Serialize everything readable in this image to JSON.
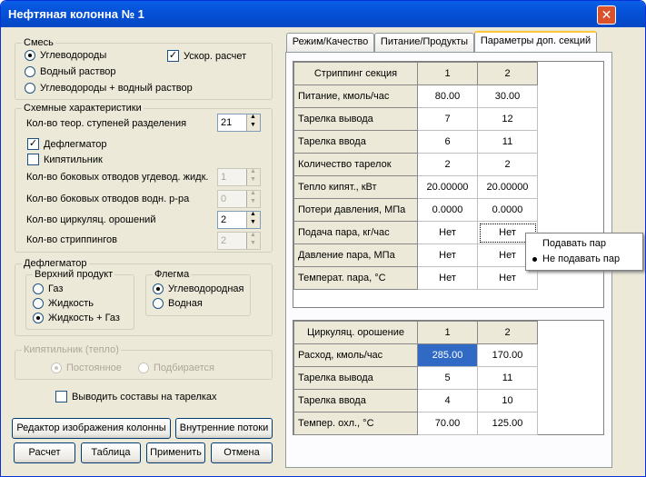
{
  "window": {
    "title": "Нефтяная колонна № 1",
    "close": "✕"
  },
  "mix": {
    "legend": "Смесь",
    "opt1": "Углеводороды",
    "opt2": "Водный раствор",
    "opt3": "Углеводороды + водный раствор",
    "accel": "Ускор. расчет"
  },
  "scheme": {
    "legend": "Схемные характеристики",
    "stages_label": "Кол-во теор. ступеней разделения",
    "stages_value": "21",
    "deflegm": "Дефлегматор",
    "boiler": "Кипятильник",
    "side_hc_label": "Кол-во боковых отводов угдевод. жидк.",
    "side_hc_value": "1",
    "side_w_label": "Кол-во боковых отводов водн. р-ра",
    "side_w_value": "0",
    "circ_label": "Кол-во циркуляц. орошений",
    "circ_value": "2",
    "strip_label": "Кол-во стриппингов",
    "strip_value": "2"
  },
  "defl": {
    "legend": "Дефлегматор",
    "top_legend": "Верхний продукт",
    "top1": "Газ",
    "top2": "Жидкость",
    "top3": "Жидкость + Газ",
    "phlegm_legend": "Флегма",
    "ph1": "Углеводородная",
    "ph2": "Водная"
  },
  "boil": {
    "legend": "Кипятильник  (тепло)",
    "o1": "Постоянное",
    "o2": "Подбирается"
  },
  "show_comp": "Выводить составы на тарелках",
  "buttons": {
    "editor": "Редактор изображения колонны",
    "flows": "Внутренние потоки",
    "calc": "Расчет",
    "table": "Таблица",
    "apply": "Применить",
    "cancel": "Отмена"
  },
  "tabs": [
    "Режим/Качество",
    "Питание/Продукты",
    "Параметры доп. секций"
  ],
  "strip": {
    "header": "Стриппинг секция",
    "cols": [
      "1",
      "2"
    ],
    "rows": [
      {
        "label": "Питание, кмоль/час",
        "v1": "80.00",
        "v2": "30.00"
      },
      {
        "label": "Тарелка вывода",
        "v1": "7",
        "v2": "12"
      },
      {
        "label": "Тарелка ввода",
        "v1": "6",
        "v2": "11"
      },
      {
        "label": "Количество тарелок",
        "v1": "2",
        "v2": "2"
      },
      {
        "label": "Тепло кипят., кВт",
        "v1": "20.00000",
        "v2": "20.00000"
      },
      {
        "label": "Потери давления, МПа",
        "v1": "0.0000",
        "v2": "0.0000"
      },
      {
        "label": "Подача пара, кг/час",
        "v1": "Нет",
        "v2": "Нет"
      },
      {
        "label": "Давление пара, МПа",
        "v1": "Нет",
        "v2": "Нет"
      },
      {
        "label": "Температ. пара, °С",
        "v1": "Нет",
        "v2": "Нет"
      }
    ]
  },
  "circ": {
    "header": "Циркуляц. орошение",
    "cols": [
      "1",
      "2"
    ],
    "rows": [
      {
        "label": "Расход, кмоль/час",
        "v1": "285.00",
        "v2": "170.00"
      },
      {
        "label": "Тарелка вывода",
        "v1": "5",
        "v2": "11"
      },
      {
        "label": "Тарелка ввода",
        "v1": "4",
        "v2": "10"
      },
      {
        "label": "Темпер. охл., °С",
        "v1": "70.00",
        "v2": "125.00"
      }
    ]
  },
  "menu": {
    "item1": "Подавать пар",
    "item2": "Не подавать пар"
  }
}
